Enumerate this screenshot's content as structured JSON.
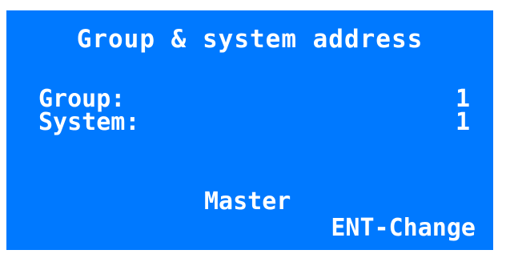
{
  "screen": {
    "title": "Group & system address",
    "fields": [
      {
        "label": "Group:",
        "value": "1"
      },
      {
        "label": "System:",
        "value": "1"
      }
    ],
    "mode": "Master",
    "action_hint": "ENT-Change",
    "background_color": "#0079ff",
    "text_color": "#ffffff"
  }
}
